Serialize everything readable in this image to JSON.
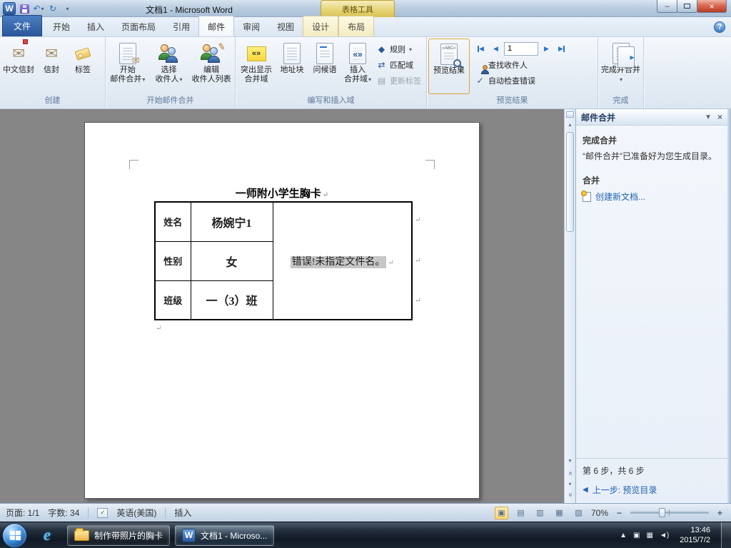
{
  "titlebar": {
    "title": "文档1 - Microsoft Word",
    "contextual_group": "表格工具"
  },
  "tabs": {
    "file": "文件",
    "home": "开始",
    "insert": "插入",
    "page_layout": "页面布局",
    "references": "引用",
    "mailings": "邮件",
    "review": "审阅",
    "view": "视图",
    "design": "设计",
    "layout": "布局"
  },
  "ribbon": {
    "create": {
      "group_label": "创建",
      "chinese_envelope": "中文信封",
      "envelope": "信封",
      "labels": "标签"
    },
    "start_merge": {
      "group_label": "开始邮件合并",
      "start_l1": "开始",
      "start_l2": "邮件合并",
      "select_l1": "选择",
      "select_l2": "收件人",
      "edit_l1": "编辑",
      "edit_l2": "收件人列表"
    },
    "write_fields": {
      "group_label": "编写和插入域",
      "highlight_l1": "突出显示",
      "highlight_l2": "合并域",
      "address_block": "地址块",
      "greeting_line": "问候语",
      "insert_l1": "插入",
      "insert_l2": "合并域",
      "rules": "规则",
      "match_fields": "匹配域",
      "update_labels": "更新标签"
    },
    "preview": {
      "group_label": "预览结果",
      "preview_results": "预览结果",
      "record_value": "1",
      "find_recipient": "查找收件人",
      "auto_check": "自动检查错误"
    },
    "finish": {
      "group_label": "完成",
      "finish_merge": "完成并合并"
    }
  },
  "document": {
    "title": "一师附小学生胸卡",
    "table": {
      "r1_label": "姓名",
      "r1_value": "杨婉宁1",
      "r2_label": "性别",
      "r2_value": "女",
      "r3_label": "班级",
      "r3_value": "一（3）班",
      "merged": "错误!未指定文件名。"
    }
  },
  "task_pane": {
    "title": "邮件合并",
    "complete_header": "完成合并",
    "description": "“邮件合并”已准备好为您生成目录。",
    "merge_header": "合并",
    "create_doc_link": "创建新文档...",
    "step_text": "第 6 步，共 6 步",
    "prev_link": "上一步: 预览目录"
  },
  "status_bar": {
    "page": "页面: 1/1",
    "words": "字数: 34",
    "language": "英语(美国)",
    "insert_mode": "插入",
    "zoom": "70%"
  },
  "taskbar": {
    "folder_app": "制作带照片的胸卡",
    "word_app": "文档1 - Microso...",
    "time": "13:46",
    "date": "2015/7/2"
  }
}
